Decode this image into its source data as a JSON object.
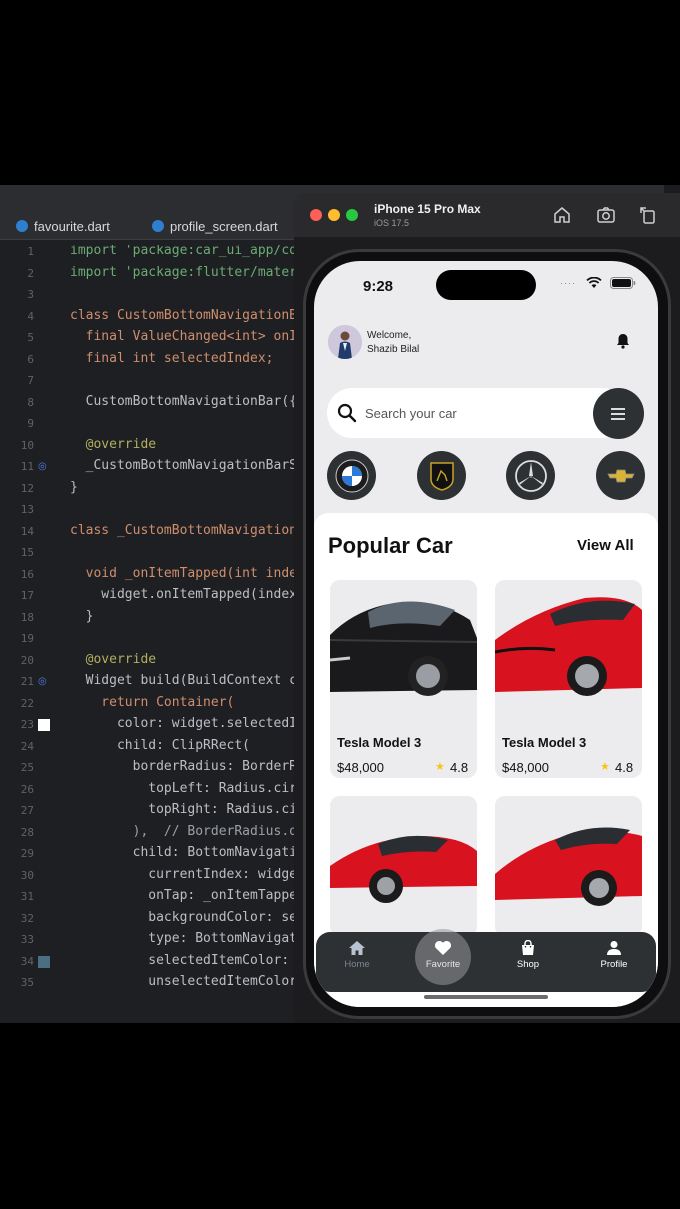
{
  "ide": {
    "tabs": [
      "favourite.dart",
      "profile_screen.dart"
    ],
    "line_numbers": [
      "1",
      "2",
      "3",
      "4",
      "5",
      "6",
      "7",
      "8",
      "9",
      "10",
      "11",
      "12",
      "13",
      "14",
      "15",
      "16",
      "17",
      "18",
      "19",
      "20",
      "21",
      "22",
      "23",
      "24",
      "25",
      "26",
      "27",
      "28",
      "29",
      "30",
      "31",
      "32",
      "33",
      "34",
      "35"
    ],
    "code_lines": [
      "import 'package:car_ui_app/core/co",
      "import 'package:flutter/materia",
      "",
      "class CustomBottomNavigationBar",
      "  final ValueChanged<int> onIte",
      "  final int selectedIndex;",
      "",
      "  CustomBottomNavigationBar({re",
      "",
      "  @override",
      "  _CustomBottomNavigationBarSta",
      "}",
      "",
      "class _CustomBottomNavigationBa",
      "",
      "  void _onItemTapped(int index)",
      "    widget.onItemTapped(index);",
      "  }",
      "",
      "  @override",
      "  Widget build(BuildContext con",
      "    return Container(",
      "      color: widget.selectedInd",
      "      child: ClipRRect(",
      "        borderRadius: BorderRad",
      "          topLeft: Radius.circu",
      "          topRight: Radius.circ",
      "        ),  // BorderRadius.onl",
      "        child: BottomNavigation",
      "          currentIndex: widget.",
      "          onTap: _onItemTapped,",
      "          backgroundColor: seco",
      "          type: BottomNavigatio",
      "          selectedItemColor: Co",
      "          unselectedItemColor: c"
    ]
  },
  "simulator": {
    "device": "iPhone 15 Pro Max",
    "os": "iOS 17.5",
    "buttons": [
      "home-icon",
      "screenshot-icon",
      "rotate-icon"
    ]
  },
  "app": {
    "status": {
      "time": "9:28"
    },
    "header": {
      "welcome": "Welcome,",
      "user": "Shazib Bilal"
    },
    "search": {
      "placeholder": "Search your car"
    },
    "brands": [
      "BMW",
      "Lamborghini",
      "Mercedes",
      "Chevrolet"
    ],
    "section": {
      "title": "Popular Car",
      "view_all": "View All"
    },
    "cars": [
      {
        "name": "Tesla Model 3",
        "price": "$48,000",
        "rating": "4.8",
        "color": "#1a1a1c"
      },
      {
        "name": "Tesla Model 3",
        "price": "$48,000",
        "rating": "4.8",
        "color": "#d8131f"
      },
      {
        "name": "",
        "price": "",
        "rating": "",
        "color": "#d8131f"
      },
      {
        "name": "",
        "price": "",
        "rating": "",
        "color": "#d8131f"
      }
    ],
    "nav": [
      {
        "label": "Home",
        "icon": "home-icon",
        "active": false
      },
      {
        "label": "Favorite",
        "icon": "heart-icon",
        "active": true
      },
      {
        "label": "Shop",
        "icon": "shopping-bag-icon",
        "active": false
      },
      {
        "label": "Profile",
        "icon": "person-icon",
        "active": false
      }
    ]
  },
  "colors": {
    "accent_dark": "#2e3133",
    "star": "#f5c518",
    "ide_bg": "#1e1f22"
  }
}
